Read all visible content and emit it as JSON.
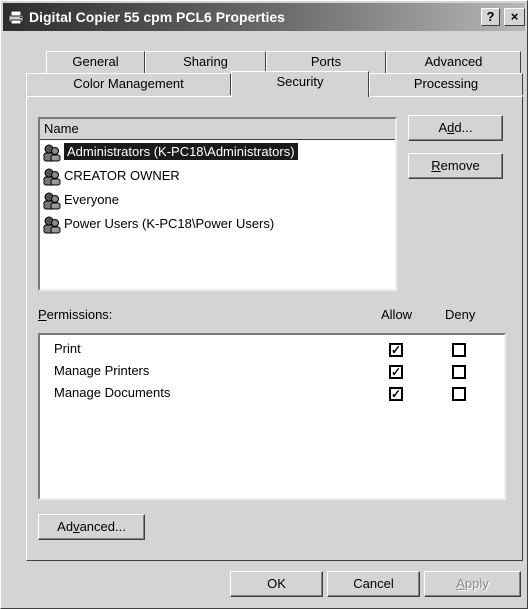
{
  "window": {
    "title": "Digital Copier 55 cpm PCL6 Properties",
    "help_label": "?",
    "close_label": "×"
  },
  "tabs": {
    "row1": [
      {
        "label": "General"
      },
      {
        "label": "Sharing"
      },
      {
        "label": "Ports"
      },
      {
        "label": "Advanced"
      }
    ],
    "row2": [
      {
        "label": "Color Management"
      },
      {
        "label": "Security",
        "active": true
      },
      {
        "label": "Processing"
      }
    ]
  },
  "users": {
    "column_header": "Name",
    "items": [
      {
        "label": "Administrators (K-PC18\\Administrators)",
        "selected": true
      },
      {
        "label": "CREATOR OWNER",
        "selected": false
      },
      {
        "label": "Everyone",
        "selected": false
      },
      {
        "label": "Power Users (K-PC18\\Power Users)",
        "selected": false
      }
    ],
    "add_button": {
      "prefix": "A",
      "mnemonic": "d",
      "suffix": "d..."
    },
    "remove_button": {
      "prefix": "",
      "mnemonic": "R",
      "suffix": "emove"
    }
  },
  "permissions": {
    "label": {
      "prefix": "",
      "mnemonic": "P",
      "suffix": "ermissions:"
    },
    "allow_header": "Allow",
    "deny_header": "Deny",
    "check_mark": "✓",
    "items": [
      {
        "label": "Print",
        "allow": true,
        "deny": false
      },
      {
        "label": "Manage Printers",
        "allow": true,
        "deny": false
      },
      {
        "label": "Manage Documents",
        "allow": true,
        "deny": false
      }
    ]
  },
  "advanced_button": {
    "prefix": "Ad",
    "mnemonic": "v",
    "suffix": "anced..."
  },
  "footer": {
    "ok_label": "OK",
    "cancel_label": "Cancel",
    "apply": {
      "prefix": "",
      "mnemonic": "A",
      "suffix": "pply"
    }
  }
}
